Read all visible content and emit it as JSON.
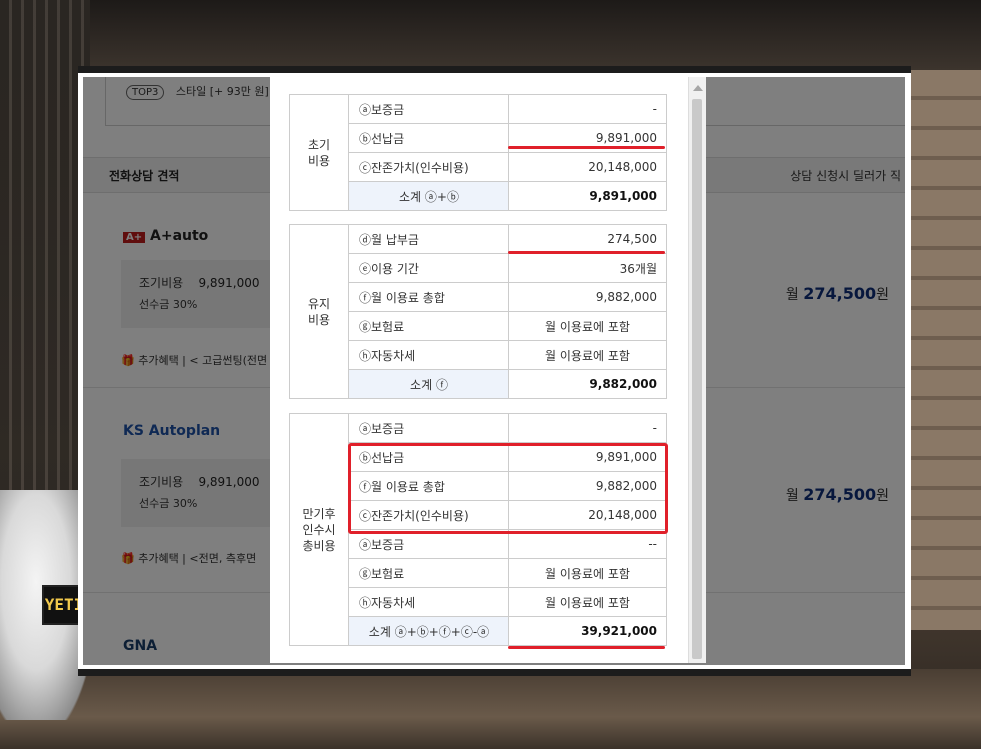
{
  "page": {
    "top3_badge": "TOP3",
    "top3_text": "스타일 [+ 93만 원]",
    "section_left": "전화상담 견적",
    "section_right": "상담 신청시 딜러가 직"
  },
  "vendors": [
    {
      "logo": "A+auto",
      "row1_label": "조기비용",
      "row1_value": "9,891,000",
      "row2": "선수금 30%",
      "benefit": "추가혜택  |  < 고급썬팅(전면",
      "price_prefix": "월 ",
      "price_value": "274,500",
      "price_suffix": "원"
    },
    {
      "logo": "KS Autoplan",
      "row1_label": "조기비용",
      "row1_value": "9,891,000",
      "row2": "선수금 30%",
      "benefit": "추가혜택  |  <전면, 측후면 ",
      "price_prefix": "월 ",
      "price_value": "274,500",
      "price_suffix": "원"
    },
    {
      "logo": "GNA"
    }
  ],
  "modal": {
    "sections": [
      {
        "category": "초기\n비용",
        "rows": [
          {
            "label": "ⓐ보증금",
            "value": "-",
            "center": false
          },
          {
            "label": "ⓑ선납금",
            "value": "9,891,000",
            "center": false
          },
          {
            "label": "ⓒ잔존가치(인수비용)",
            "value": "20,148,000",
            "center": false
          }
        ],
        "subtotal_label": "소계 ⓐ+ⓑ",
        "subtotal_value": "9,891,000"
      },
      {
        "category": "유지\n비용",
        "rows": [
          {
            "label": "ⓓ월 납부금",
            "value": "274,500",
            "center": false
          },
          {
            "label": "ⓔ이용 기간",
            "value": "36개월",
            "center": false
          },
          {
            "label": "ⓕ월 이용료 총합",
            "value": "9,882,000",
            "center": false
          },
          {
            "label": "ⓖ보험료",
            "value": "월 이용료에 포함",
            "center": true
          },
          {
            "label": "ⓗ자동차세",
            "value": "월 이용료에 포함",
            "center": true
          }
        ],
        "subtotal_label": "소계 ⓕ",
        "subtotal_value": "9,882,000"
      },
      {
        "category": "만기후\n인수시\n총비용",
        "rows": [
          {
            "label": "ⓐ보증금",
            "value": "-",
            "center": false
          },
          {
            "label": "ⓑ선납금",
            "value": "9,891,000",
            "center": false
          },
          {
            "label": "ⓕ월 이용료 총합",
            "value": "9,882,000",
            "center": false
          },
          {
            "label": "ⓒ잔존가치(인수비용)",
            "value": "20,148,000",
            "center": false
          },
          {
            "label": "ⓐ보증금",
            "value": "--",
            "center": false
          },
          {
            "label": "ⓖ보험료",
            "value": "월 이용료에 포함",
            "center": true
          },
          {
            "label": "ⓗ자동차세",
            "value": "월 이용료에 포함",
            "center": true
          }
        ],
        "subtotal_label": "소계 ⓐ+ⓑ+ⓕ+ⓒ-ⓐ",
        "subtotal_value": "39,921,000"
      }
    ]
  },
  "background": {
    "plate_text": "YETI"
  },
  "colors": {
    "highlight": "#e0202a",
    "price": "#0e2f7a",
    "subtotal_bg": "#eef3fb"
  }
}
